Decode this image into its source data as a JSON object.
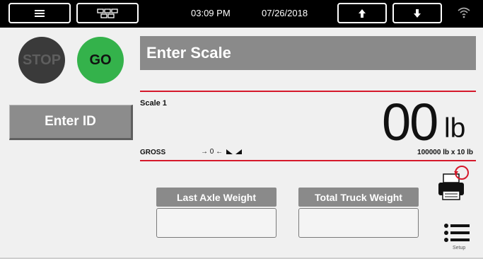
{
  "topbar": {
    "menu_icon": "hamburger-menu-icon",
    "apps_icon": "grid-icon",
    "time": "03:09 PM",
    "date": "07/26/2018",
    "up_icon": "arrow-up-icon",
    "down_icon": "arrow-down-icon",
    "wifi_icon": "wifi-icon"
  },
  "controls": {
    "stop_label": "STOP",
    "go_label": "GO",
    "enter_id_label": "Enter ID"
  },
  "main": {
    "title": "Enter Scale",
    "scale_name": "Scale 1",
    "weight_value": "00",
    "weight_unit": "lb",
    "mode": "GROSS",
    "zero_indicator": "→ 0 ←",
    "capacity": "100000 lb x 10 lb"
  },
  "boxes": {
    "last_axle_title": "Last Axle Weight",
    "last_axle_value": "",
    "total_truck_title": "Total Truck Weight",
    "total_truck_value": ""
  },
  "side": {
    "print_icon": "printer-icon",
    "setup_icon": "list-icon",
    "setup_label": "Setup"
  },
  "colors": {
    "go": "#34b24b",
    "stop": "#3a3a3a",
    "accent_line": "#d5192b",
    "banner": "#8a8a8a"
  }
}
